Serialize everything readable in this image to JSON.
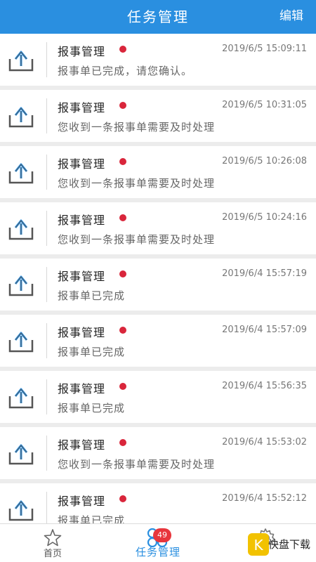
{
  "header": {
    "title": "任务管理",
    "edit_label": "编辑"
  },
  "items": [
    {
      "title": "报事管理",
      "time": "2019/6/5 15:09:11",
      "message": "报事单已完成，请您确认。"
    },
    {
      "title": "报事管理",
      "time": "2019/6/5 10:31:05",
      "message": "您收到一条报事单需要及时处理"
    },
    {
      "title": "报事管理",
      "time": "2019/6/5 10:26:08",
      "message": "您收到一条报事单需要及时处理"
    },
    {
      "title": "报事管理",
      "time": "2019/6/5 10:24:16",
      "message": "您收到一条报事单需要及时处理"
    },
    {
      "title": "报事管理",
      "time": "2019/6/4 15:57:19",
      "message": "报事单已完成"
    },
    {
      "title": "报事管理",
      "time": "2019/6/4 15:57:09",
      "message": "报事单已完成"
    },
    {
      "title": "报事管理",
      "time": "2019/6/4 15:56:35",
      "message": "报事单已完成"
    },
    {
      "title": "报事管理",
      "time": "2019/6/4 15:53:02",
      "message": "您收到一条报事单需要及时处理"
    },
    {
      "title": "报事管理",
      "time": "2019/6/4 15:52:12",
      "message": "报事单已完成"
    }
  ],
  "tabs": [
    {
      "label": "首页",
      "icon": "star-icon"
    },
    {
      "label": "任务管理",
      "icon": "grid-icon",
      "badge": "49"
    },
    {
      "label": "",
      "icon": "gear-icon"
    }
  ],
  "watermark_text": "快盘下载",
  "colors": {
    "primary": "#2a8fe0",
    "unread_dot": "#d9263b",
    "badge": "#e8353c"
  }
}
